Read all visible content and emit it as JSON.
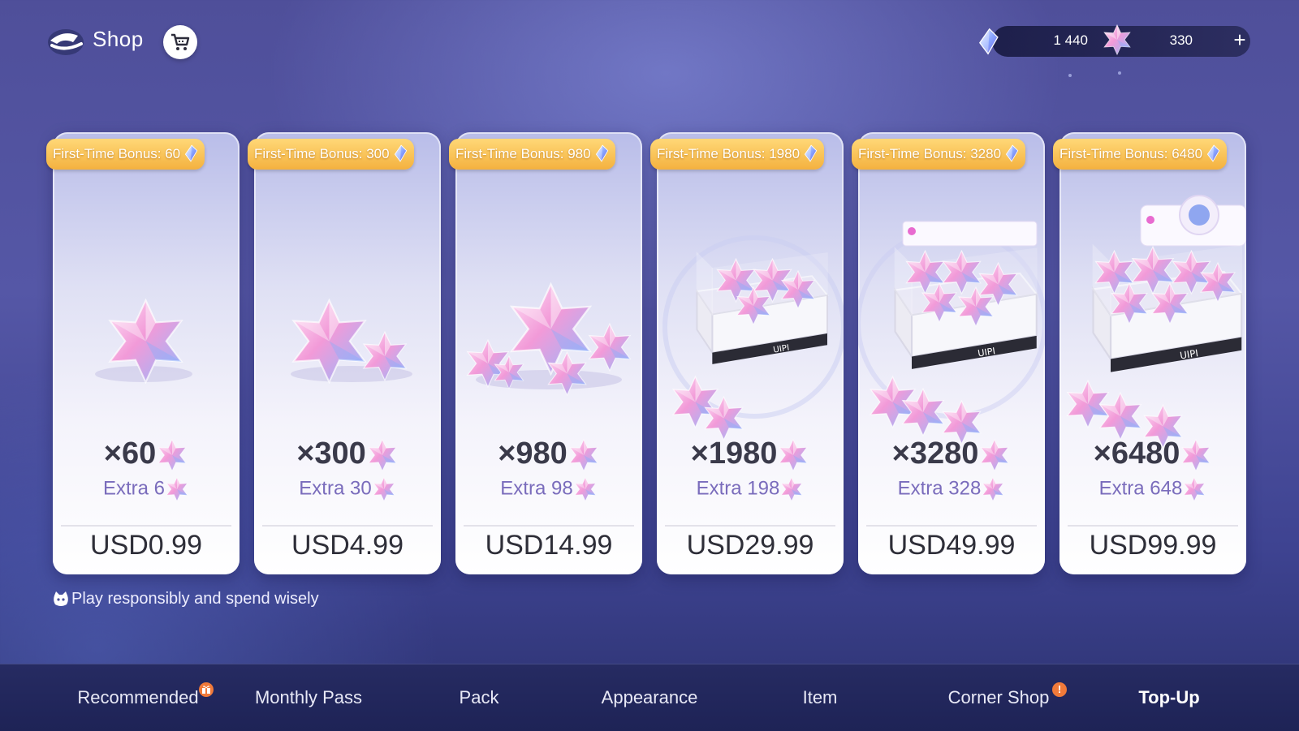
{
  "header": {
    "title": "Shop",
    "back_icon": "back-arrow-icon",
    "cart_icon": "cart-icon"
  },
  "currencies": [
    {
      "icon": "crystal-icon",
      "value": "1 440"
    },
    {
      "icon": "star-gem-icon",
      "value": "330"
    }
  ],
  "add_currency_label": "+",
  "products": [
    {
      "bonus": "First-Time Bonus:  60",
      "quantity": "×60",
      "extra": "Extra  6",
      "price": "USD0.99",
      "art": "single-star"
    },
    {
      "bonus": "First-Time Bonus:  300",
      "quantity": "×300",
      "extra": "Extra  30",
      "price": "USD4.99",
      "art": "two-stars"
    },
    {
      "bonus": "First-Time Bonus:  980",
      "quantity": "×980",
      "extra": "Extra  98",
      "price": "USD14.99",
      "art": "star-cluster"
    },
    {
      "bonus": "First-Time Bonus:  1980",
      "quantity": "×1980",
      "extra": "Extra  198",
      "price": "USD29.99",
      "art": "small-box"
    },
    {
      "bonus": "First-Time Bonus:  3280",
      "quantity": "×3280",
      "extra": "Extra  328",
      "price": "USD49.99",
      "art": "medium-box"
    },
    {
      "bonus": "First-Time Bonus:  6480",
      "quantity": "×6480",
      "extra": "Extra  648",
      "price": "USD99.99",
      "art": "large-box"
    }
  ],
  "notice": "Play responsibly and spend wisely",
  "nav": {
    "tabs": [
      {
        "label": "Recommended",
        "badge": "gift"
      },
      {
        "label": "Monthly Pass"
      },
      {
        "label": "Pack"
      },
      {
        "label": "Appearance"
      },
      {
        "label": "Item"
      },
      {
        "label": "Corner Shop",
        "badge": "!"
      },
      {
        "label": "Top-Up",
        "active": true
      }
    ]
  },
  "colors": {
    "bonus_ribbon": "#f4b13f",
    "star_pink": "#f3a6dc",
    "star_blue": "#9fc4ff",
    "active_tab": "#ffffff",
    "badge": "#f07a3a"
  }
}
